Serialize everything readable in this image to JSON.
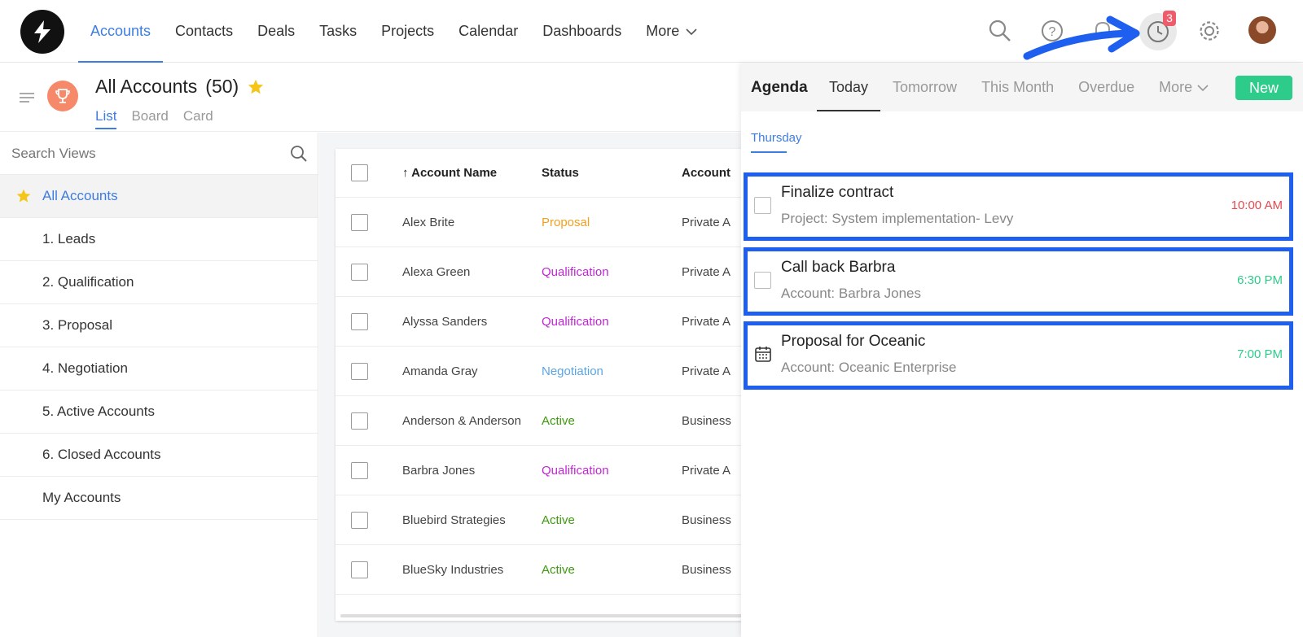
{
  "nav": {
    "items": [
      {
        "label": "Accounts",
        "active": true
      },
      {
        "label": "Contacts"
      },
      {
        "label": "Deals"
      },
      {
        "label": "Tasks"
      },
      {
        "label": "Projects"
      },
      {
        "label": "Calendar"
      },
      {
        "label": "Dashboards"
      }
    ],
    "more_label": "More",
    "notification_count": "3"
  },
  "page": {
    "title": "All Accounts",
    "count": "(50)",
    "view_tabs": [
      "List",
      "Board",
      "Card"
    ]
  },
  "sidebar": {
    "search_placeholder": "Search Views",
    "views": [
      "All Accounts",
      "1. Leads",
      "2. Qualification",
      "3. Proposal",
      "4. Negotiation",
      "5. Active Accounts",
      "6. Closed Accounts",
      "My Accounts"
    ]
  },
  "table": {
    "headers": {
      "sort_arrow": "↑",
      "name": "Account Name",
      "status": "Status",
      "type": "Account"
    },
    "rows": [
      {
        "name": "Alex Brite",
        "status": "Proposal",
        "status_color": "#f0a020",
        "type": "Private A"
      },
      {
        "name": "Alexa Green",
        "status": "Qualification",
        "status_color": "#c026d3",
        "type": "Private A"
      },
      {
        "name": "Alyssa Sanders",
        "status": "Qualification",
        "status_color": "#c026d3",
        "type": "Private A"
      },
      {
        "name": "Amanda Gray",
        "status": "Negotiation",
        "status_color": "#5aa5e6",
        "type": "Private A"
      },
      {
        "name": "Anderson & Anderson",
        "status": "Active",
        "status_color": "#3e9a0e",
        "type": "Business"
      },
      {
        "name": "Barbra Jones",
        "status": "Qualification",
        "status_color": "#c026d3",
        "type": "Private A"
      },
      {
        "name": "Bluebird Strategies",
        "status": "Active",
        "status_color": "#3e9a0e",
        "type": "Business"
      },
      {
        "name": "BlueSky Industries",
        "status": "Active",
        "status_color": "#3e9a0e",
        "type": "Business"
      }
    ]
  },
  "agenda": {
    "title": "Agenda",
    "tabs": [
      "Today",
      "Tomorrow",
      "This Month",
      "Overdue"
    ],
    "more_label": "More",
    "new_label": "New",
    "day": "Thursday",
    "items": [
      {
        "title": "Finalize contract",
        "sub": "Project: System implementation- Levy",
        "time": "10:00 AM",
        "time_color": "#e5484d",
        "kind": "task"
      },
      {
        "title": "Call back Barbra",
        "sub": "Account: Barbra Jones",
        "time": "6:30 PM",
        "time_color": "#2ecc8b",
        "kind": "task"
      },
      {
        "title": "Proposal for Oceanic",
        "sub": "Account: Oceanic Enterprise",
        "time": "7:00 PM",
        "time_color": "#2ecc8b",
        "kind": "event"
      }
    ]
  },
  "colors": {
    "accent": "#3e7de0",
    "new_button": "#2ecc8b",
    "highlight_border": "#1f5ff0",
    "badge": "#ef5b6b"
  }
}
